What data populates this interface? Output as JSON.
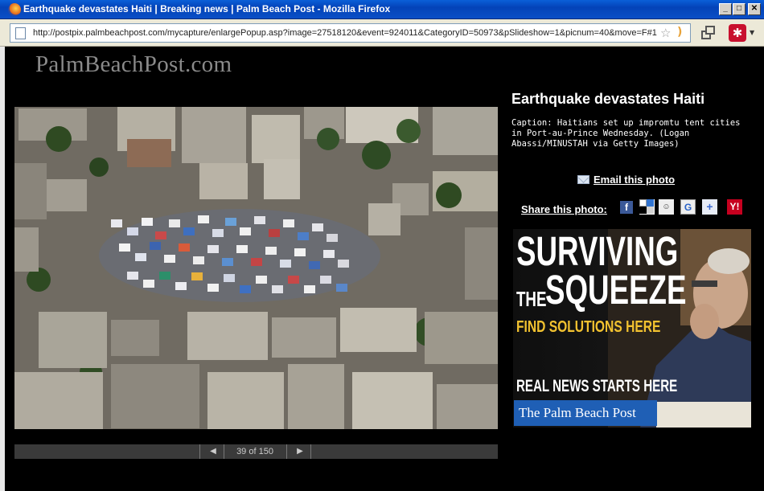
{
  "window": {
    "title": "Earthquake devastates Haiti | Breaking news | Palm Beach Post - Mozilla Firefox",
    "controls": {
      "minimize": "_",
      "maximize": "□",
      "close": "✕"
    }
  },
  "navbar": {
    "url": "http://postpix.palmbeachpost.com/mycapture/enlargePopup.asp?image=27518120&event=924011&CategoryID=50973&pSlideshow=1&picnum=40&move=F#1",
    "icons": [
      "page-icon",
      "bookmark-star-icon",
      "rss-icon",
      "restore-window-icon",
      "addon-icon",
      "dropdown-icon"
    ]
  },
  "site": {
    "logo": "PalmBeachPost.com"
  },
  "photo": {
    "alt": "Aerial view of tent city among damaged buildings"
  },
  "slideshow": {
    "prev": "◀",
    "counter": "39 of 150",
    "next": "▶"
  },
  "article": {
    "headline": "Earthquake devastates Haiti",
    "caption": "Caption: Haitians set up impromtu tent cities in Port-au-Prince Wednesday. (Logan Abassi/MINUSTAH via Getty Images)"
  },
  "actions": {
    "email_label": "Email this photo",
    "share_label": "Share this photo:",
    "share_icons": {
      "facebook": "f",
      "digg": "digg",
      "google": "G",
      "yahoo": "+",
      "y": "Y!"
    }
  },
  "ad": {
    "line1": "SURVIVING",
    "line2a": "THE",
    "line2b": "SQUEEZE",
    "cta": "FIND SOLUTIONS HERE",
    "tagline": "REAL NEWS STARTS HERE",
    "brand": "The Palm Beach Post",
    "accent_color": "#f2c230",
    "brand_color": "#1f5fb5"
  }
}
